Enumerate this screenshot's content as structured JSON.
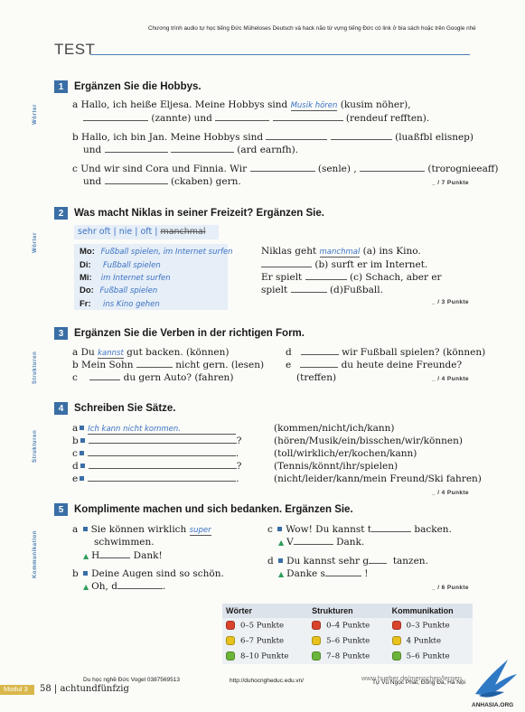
{
  "top_note": "Chương trình audio tự học tiếng Đức Müheloses Deutsch và hack não từ vựng tiếng Đức có link ở bìa sách hoặc trên Google nhé",
  "test_title": "TEST",
  "sections": {
    "s1": {
      "num": "1",
      "title": "Ergänzen Sie die Hobbys.",
      "side": "Wörter",
      "score": "_ / 7 Punkte",
      "a1": "a  Hallo, ich heiße Eljesa. Meine Hobbys sind",
      "a1_hw": "Musik hören",
      "a1_end": "(kusim nöher),",
      "a2_mid": "(zannte) und",
      "a2_end": "(rendeuf refften).",
      "b1": "b  Hallo, ich bin Jan. Meine Hobbys sind",
      "b1_end": "(luaßfbl elisnep)",
      "b2_start": "und",
      "b2_end": "(ard earnfh).",
      "c1": "c  Und wir sind Cora und Finnia. Wir",
      "c1_mid": "(senle) ,",
      "c1_end": "(trorognieeaff)",
      "c2_start": "und",
      "c2_end": "(ckaben) gern."
    },
    "s2": {
      "num": "2",
      "title": "Was macht Niklas in seiner Freizeit? Ergänzen Sie.",
      "side": "Wörter",
      "score": "_ / 3 Punkte",
      "words": [
        "sehr oft",
        "nie",
        "oft",
        "manchmal"
      ],
      "days": [
        {
          "d": "Mo:",
          "t": "Fußball spielen, im Internet surfen"
        },
        {
          "d": "Di:",
          "t": "Fußball spielen"
        },
        {
          "d": "Mi:",
          "t": "im Internet surfen"
        },
        {
          "d": "Do:",
          "t": "Fußball spielen"
        },
        {
          "d": "Fr:",
          "t": "ins Kino gehen"
        }
      ],
      "r1": "Niklas geht",
      "r1_hw": "manchmal",
      "r1_end": "(a) ins Kino.",
      "r2_end": "(b) surft er im Internet.",
      "r3_start": "Er spielt",
      "r3_end": "(c) Schach, aber er",
      "r4_start": "spielt",
      "r4_end": "(d)Fußball."
    },
    "s3": {
      "num": "3",
      "title": "Ergänzen Sie die Verben in der richtigen Form.",
      "side": "Strukturen",
      "score": "_ / 4 Punkte",
      "a_start": "a  Du",
      "a_hw": "kannst",
      "a_end": "gut backen. (können)",
      "b_start": "b  Mein Sohn",
      "b_end": "nicht gern. (lesen)",
      "c_start": "c",
      "c_end": "du gern Auto? (fahren)",
      "d_start": "d",
      "d_end": "wir Fußball spielen? (können)",
      "e_start": "e",
      "e_end": "du heute deine Freunde?",
      "e2": "(treffen)"
    },
    "s4": {
      "num": "4",
      "title": "Schreiben Sie Sätze.",
      "side": "Strukturen",
      "score": "_ / 4 Punkte",
      "rows": [
        {
          "l": "a",
          "hw": "Ich kann nicht kommen.",
          "p": "",
          "r": "(kommen/nicht/ich/kann)"
        },
        {
          "l": "b",
          "hw": "",
          "p": "?",
          "r": "(hören/Musik/ein/bisschen/wir/können)"
        },
        {
          "l": "c",
          "hw": "",
          "p": ".",
          "r": "(toll/wirklich/er/kochen/kann)"
        },
        {
          "l": "d",
          "hw": "",
          "p": "?",
          "r": "(Tennis/könnt/ihr/spielen)"
        },
        {
          "l": "e",
          "hw": "",
          "p": ".",
          "r": "(nicht/leider/kann/mein Freund/Ski fahren)"
        }
      ]
    },
    "s5": {
      "num": "5",
      "title": "Komplimente machen und sich bedanken. Ergänzen Sie.",
      "side": "Kommunikation",
      "score": "_ / 6 Punkte",
      "a1": "Sie können wirklich",
      "a1_hw": "super",
      "a1b": "schwimmen.",
      "a2": "H",
      "a2_end": "Dank!",
      "b1": "Deine Augen sind so schön.",
      "b2": "Oh, d",
      "c1": "Wow! Du kannst t",
      "c1_end": "backen.",
      "c2": "V",
      "c2_end": "Dank.",
      "d1": "Du kannst sehr g",
      "d1_end": "tanzen.",
      "d2": "Danke s",
      "d2_end": "!"
    }
  },
  "score_table": {
    "headers": [
      "Wörter",
      "Strukturen",
      "Kommunikation"
    ],
    "rows": [
      [
        "0–5 Punkte",
        "0–4 Punkte",
        "0–3 Punkte"
      ],
      [
        "6–7 Punkte",
        "5–6 Punkte",
        "4 Punkte"
      ],
      [
        "8–10 Punkte",
        "7–8 Punkte",
        "5–6 Punkte"
      ]
    ],
    "colors": [
      "#d9432c",
      "#e8c21c",
      "#6bb53a"
    ]
  },
  "footer": {
    "module": "Modul 3",
    "page": "58  |  achtundfünfzig",
    "left": "Du học nghề Đức Vogel 0387569513",
    "mid": "http://duhocngheduc.edu.vn/",
    "url": "www.hueber.de/menschen/lernen",
    "right": "Tự Vũ Ngọc Phát, Đống Đa, Hà Nội",
    "logo": "ANHASIA.ORG"
  }
}
